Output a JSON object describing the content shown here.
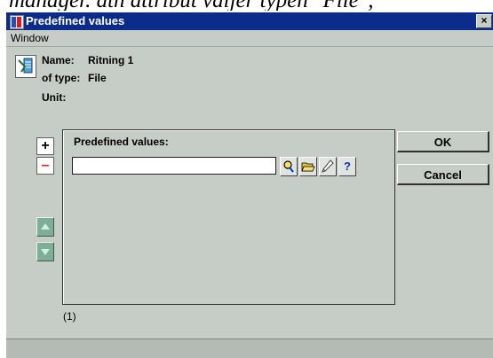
{
  "background_text": "manager. ath attribut väljer typen \"File\",",
  "window": {
    "title": "Predefined values",
    "close_glyph": "×"
  },
  "menu": {
    "items": [
      "Window"
    ]
  },
  "info": {
    "name_label": "Name:",
    "name_value": "Ritning 1",
    "type_label": "of type:",
    "type_value": "File",
    "unit_label": "Unit:"
  },
  "side_buttons": {
    "add_glyph": "+",
    "remove_glyph": "–"
  },
  "panel": {
    "title": "Predefined values:",
    "input_value": "",
    "help_glyph": "?"
  },
  "buttons": {
    "ok": "OK",
    "cancel": "Cancel"
  },
  "count_text": "(1)",
  "colors": {
    "titlebar": "#0c2c8c",
    "window_bg": "#c6ccc6",
    "arrow_btn": "#7fae98",
    "remove_red": "#e01818"
  }
}
